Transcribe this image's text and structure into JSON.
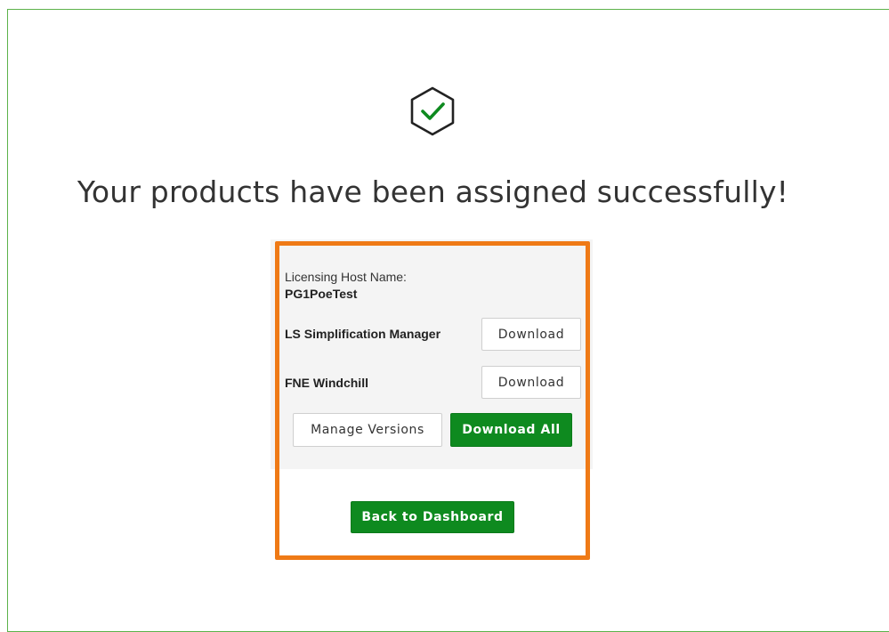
{
  "title": "Your products have been assigned successfully!",
  "icons": {
    "success": "check-hexagon-icon"
  },
  "colors": {
    "primary_green": "#0e8a1f",
    "frame_green": "#5cb24a",
    "highlight_orange": "#ef7a16",
    "panel_bg": "#f4f4f4"
  },
  "host": {
    "label": "Licensing Host Name:",
    "value": "PG1PoeTest"
  },
  "products": [
    {
      "name": "LS Simplification Manager",
      "action": "Download"
    },
    {
      "name": "FNE Windchill",
      "action": "Download"
    }
  ],
  "actions": {
    "manage_versions": "Manage Versions",
    "download_all": "Download All",
    "back_to_dashboard": "Back to Dashboard"
  }
}
